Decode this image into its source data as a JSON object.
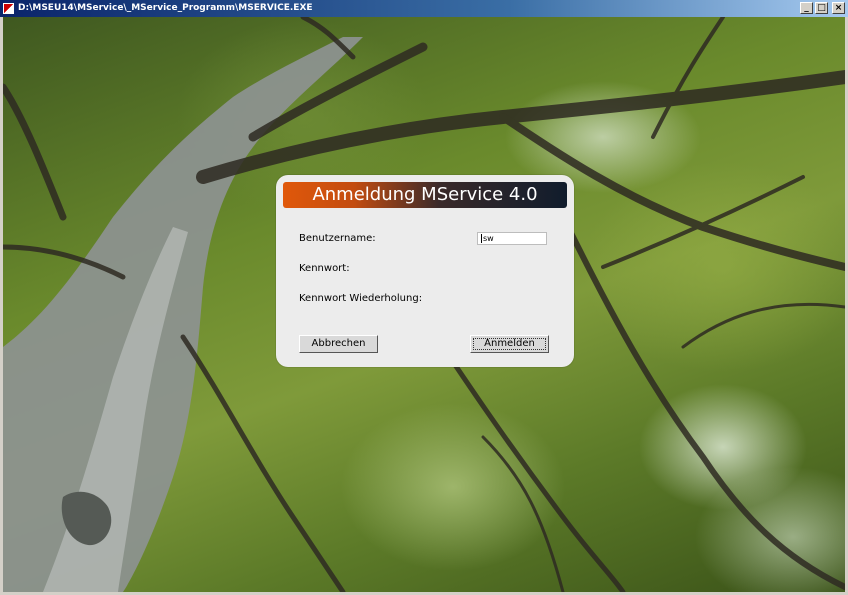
{
  "window": {
    "title": "D:\\MSEU14\\MService\\_MService_Programm\\MSERVICE.EXE",
    "controls": {
      "minimize": "_",
      "maximize": "□",
      "close": "×"
    }
  },
  "dialog": {
    "title": "Anmeldung  MService 4.0",
    "fields": {
      "username_label": "Benutzername:",
      "username_value": "sw",
      "password_label": "Kennwort:",
      "password_repeat_label": "Kennwort Wiederholung:"
    },
    "buttons": {
      "cancel": "Abbrechen",
      "login": "Anmelden"
    }
  },
  "colors": {
    "titlebar_start": "#0a246a",
    "dialog_header_left": "#e0580a",
    "dialog_header_right": "#101c2c",
    "dialog_bg": "#ececec"
  },
  "icons": {
    "app": "app-icon"
  }
}
